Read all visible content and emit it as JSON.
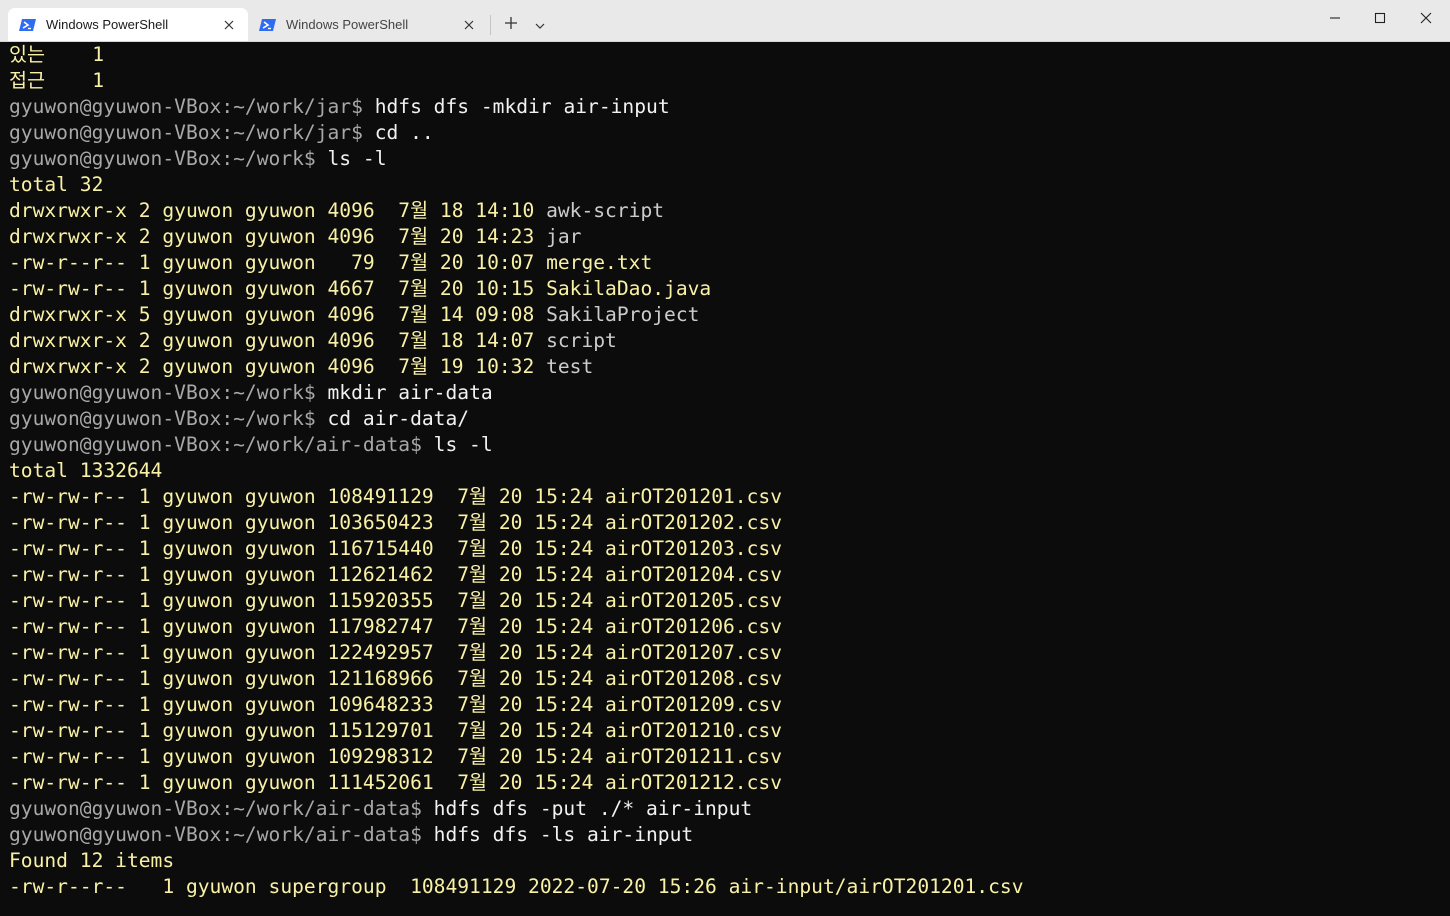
{
  "titlebar": {
    "tabs": [
      {
        "label": "Windows PowerShell",
        "active": true
      },
      {
        "label": "Windows PowerShell",
        "active": false
      }
    ],
    "new_tab_icon": "plus-icon",
    "dropdown_icon": "chevron-down-icon",
    "window_controls": [
      "minimize-icon",
      "maximize-icon",
      "close-icon"
    ]
  },
  "colors": {
    "background": "#0c0c0c",
    "output_text": "#f9f1a5",
    "command_text": "#f2f2f2",
    "prompt_text": "#a8a8a8",
    "titlebar": "#e9e9e9",
    "powershell_icon": "#2f6cf2"
  },
  "terminal": {
    "lines": [
      {
        "segments": [
          {
            "text": "있는    1",
            "style": "yellow"
          }
        ]
      },
      {
        "segments": [
          {
            "text": "접근    1",
            "style": "yellow"
          }
        ]
      },
      {
        "segments": [
          {
            "text": "gyuwon@gyuwon-VBox:~/work/jar$ ",
            "style": "grey"
          },
          {
            "text": "hdfs dfs -mkdir air-input",
            "style": "white"
          }
        ]
      },
      {
        "segments": [
          {
            "text": "gyuwon@gyuwon-VBox:~/work/jar$ ",
            "style": "grey"
          },
          {
            "text": "cd ..",
            "style": "white"
          }
        ]
      },
      {
        "segments": [
          {
            "text": "gyuwon@gyuwon-VBox:~/work$ ",
            "style": "grey"
          },
          {
            "text": "ls -l",
            "style": "white"
          }
        ]
      },
      {
        "segments": [
          {
            "text": "total 32",
            "style": "yellow"
          }
        ]
      },
      {
        "segments": [
          {
            "text": "drwxrwxr-x 2 gyuwon gyuwon 4096  7월 18 14:10 ",
            "style": "yellow"
          },
          {
            "text": "awk-script",
            "style": "dir"
          }
        ]
      },
      {
        "segments": [
          {
            "text": "drwxrwxr-x 2 gyuwon gyuwon 4096  7월 20 14:23 ",
            "style": "yellow"
          },
          {
            "text": "jar",
            "style": "dir"
          }
        ]
      },
      {
        "segments": [
          {
            "text": "-rw-r--r-- 1 gyuwon gyuwon   79  7월 20 10:07 merge.txt",
            "style": "yellow"
          }
        ]
      },
      {
        "segments": [
          {
            "text": "-rw-rw-r-- 1 gyuwon gyuwon 4667  7월 20 10:15 SakilaDao.java",
            "style": "yellow"
          }
        ]
      },
      {
        "segments": [
          {
            "text": "drwxrwxr-x 5 gyuwon gyuwon 4096  7월 14 09:08 ",
            "style": "yellow"
          },
          {
            "text": "SakilaProject",
            "style": "dir"
          }
        ]
      },
      {
        "segments": [
          {
            "text": "drwxrwxr-x 2 gyuwon gyuwon 4096  7월 18 14:07 ",
            "style": "yellow"
          },
          {
            "text": "script",
            "style": "dir"
          }
        ]
      },
      {
        "segments": [
          {
            "text": "drwxrwxr-x 2 gyuwon gyuwon 4096  7월 19 10:32 ",
            "style": "yellow"
          },
          {
            "text": "test",
            "style": "dir"
          }
        ]
      },
      {
        "segments": [
          {
            "text": "gyuwon@gyuwon-VBox:~/work$ ",
            "style": "grey"
          },
          {
            "text": "mkdir air-data",
            "style": "white"
          }
        ]
      },
      {
        "segments": [
          {
            "text": "gyuwon@gyuwon-VBox:~/work$ ",
            "style": "grey"
          },
          {
            "text": "cd air-data/",
            "style": "white"
          }
        ]
      },
      {
        "segments": [
          {
            "text": "gyuwon@gyuwon-VBox:~/work/air-data$ ",
            "style": "grey"
          },
          {
            "text": "ls -l",
            "style": "white"
          }
        ]
      },
      {
        "segments": [
          {
            "text": "total 1332644",
            "style": "yellow"
          }
        ]
      },
      {
        "segments": [
          {
            "text": "-rw-rw-r-- 1 gyuwon gyuwon 108491129  7월 20 15:24 airOT201201.csv",
            "style": "yellow"
          }
        ]
      },
      {
        "segments": [
          {
            "text": "-rw-rw-r-- 1 gyuwon gyuwon 103650423  7월 20 15:24 airOT201202.csv",
            "style": "yellow"
          }
        ]
      },
      {
        "segments": [
          {
            "text": "-rw-rw-r-- 1 gyuwon gyuwon 116715440  7월 20 15:24 airOT201203.csv",
            "style": "yellow"
          }
        ]
      },
      {
        "segments": [
          {
            "text": "-rw-rw-r-- 1 gyuwon gyuwon 112621462  7월 20 15:24 airOT201204.csv",
            "style": "yellow"
          }
        ]
      },
      {
        "segments": [
          {
            "text": "-rw-rw-r-- 1 gyuwon gyuwon 115920355  7월 20 15:24 airOT201205.csv",
            "style": "yellow"
          }
        ]
      },
      {
        "segments": [
          {
            "text": "-rw-rw-r-- 1 gyuwon gyuwon 117982747  7월 20 15:24 airOT201206.csv",
            "style": "yellow"
          }
        ]
      },
      {
        "segments": [
          {
            "text": "-rw-rw-r-- 1 gyuwon gyuwon 122492957  7월 20 15:24 airOT201207.csv",
            "style": "yellow"
          }
        ]
      },
      {
        "segments": [
          {
            "text": "-rw-rw-r-- 1 gyuwon gyuwon 121168966  7월 20 15:24 airOT201208.csv",
            "style": "yellow"
          }
        ]
      },
      {
        "segments": [
          {
            "text": "-rw-rw-r-- 1 gyuwon gyuwon 109648233  7월 20 15:24 airOT201209.csv",
            "style": "yellow"
          }
        ]
      },
      {
        "segments": [
          {
            "text": "-rw-rw-r-- 1 gyuwon gyuwon 115129701  7월 20 15:24 airOT201210.csv",
            "style": "yellow"
          }
        ]
      },
      {
        "segments": [
          {
            "text": "-rw-rw-r-- 1 gyuwon gyuwon 109298312  7월 20 15:24 airOT201211.csv",
            "style": "yellow"
          }
        ]
      },
      {
        "segments": [
          {
            "text": "-rw-rw-r-- 1 gyuwon gyuwon 111452061  7월 20 15:24 airOT201212.csv",
            "style": "yellow"
          }
        ]
      },
      {
        "segments": [
          {
            "text": "gyuwon@gyuwon-VBox:~/work/air-data$ ",
            "style": "grey"
          },
          {
            "text": "hdfs dfs -put ./* air-input",
            "style": "white"
          }
        ]
      },
      {
        "segments": [
          {
            "text": "gyuwon@gyuwon-VBox:~/work/air-data$ ",
            "style": "grey"
          },
          {
            "text": "hdfs dfs -ls air-input",
            "style": "white"
          }
        ]
      },
      {
        "segments": [
          {
            "text": "Found 12 items",
            "style": "yellow"
          }
        ]
      },
      {
        "segments": [
          {
            "text": "-rw-r--r--   1 gyuwon supergroup  108491129 2022-07-20 15:26 air-input/airOT201201.csv",
            "style": "yellow"
          }
        ]
      }
    ]
  }
}
